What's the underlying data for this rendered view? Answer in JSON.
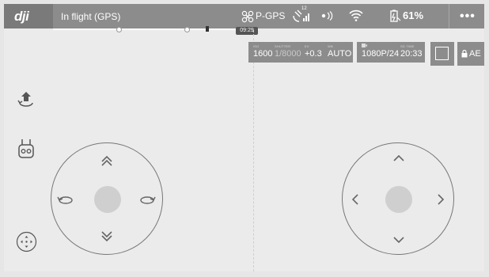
{
  "app": {
    "logo": "dji"
  },
  "top_bar": {
    "status": "In flight (GPS)",
    "mode": "P-GPS",
    "gps_count": "12",
    "battery": "61%",
    "more": "•••"
  },
  "timeline": {
    "time": "09:29"
  },
  "camera": {
    "iso": {
      "label": "ISO",
      "value": "1600"
    },
    "shutter": {
      "label": "SHUTTER",
      "value": "1/8000"
    },
    "ev": {
      "label": "EV",
      "value": "+0.3"
    },
    "wb": {
      "label": "WB",
      "value": "AUTO"
    },
    "resolution": {
      "label": "",
      "value": "1080P/24"
    },
    "sd_time": {
      "label": "SD TIME",
      "value": "20:33"
    },
    "ae_label": "AE"
  },
  "colors": {
    "bar": "#8c8c8c",
    "background": "#ebebeb",
    "knob": "#cfcfcf"
  },
  "icons": {
    "takeoff": "takeoff-icon",
    "remote": "remote-controller-icon",
    "joystick": "joystick-mode-icon",
    "drone": "drone-icon",
    "satellite": "satellite-signal-icon",
    "wifi": "wifi-icon",
    "battery": "battery-icon",
    "lock": "lock-icon"
  }
}
